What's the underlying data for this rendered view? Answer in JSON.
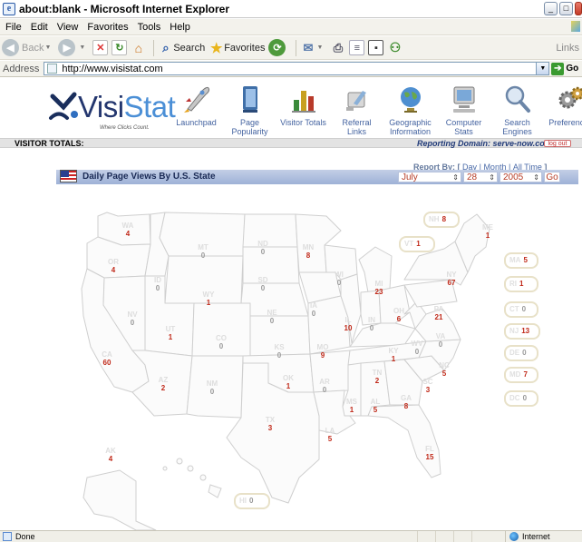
{
  "window": {
    "title": "about:blank - Microsoft Internet Explorer"
  },
  "menu": [
    "File",
    "Edit",
    "View",
    "Favorites",
    "Tools",
    "Help"
  ],
  "toolbar": {
    "back": "Back",
    "search": "Search",
    "favorites": "Favorites",
    "links": "Links"
  },
  "address": {
    "label": "Address",
    "url": "http://www.visistat.com",
    "go": "Go"
  },
  "brand": {
    "name": "VisiStat",
    "tagline": "Where Clicks Count."
  },
  "nav": [
    {
      "label": "Launchpad",
      "icon": "rocket-icon"
    },
    {
      "label": "Page Popularity",
      "icon": "book-icon"
    },
    {
      "label": "Visitor Totals",
      "icon": "bar-chart-icon"
    },
    {
      "label": "Referral Links",
      "icon": "referral-hand-icon"
    },
    {
      "label": "Geographic Information",
      "icon": "globe-icon"
    },
    {
      "label": "Computer Stats",
      "icon": "computer-icon"
    },
    {
      "label": "Search Engines",
      "icon": "magnifier-icon"
    },
    {
      "label": "Preferences",
      "icon": "gears-icon"
    }
  ],
  "totals_bar": {
    "label": "VISITOR TOTALS:",
    "domain_label": "Reporting Domain:",
    "domain": "serve-now.com",
    "logout": "log out"
  },
  "report": {
    "by_label": "Report By:",
    "open_bracket": "[",
    "close_bracket": "]",
    "options": [
      "Day",
      "Month",
      "All Time"
    ],
    "separator": "|",
    "panel_title": "Daily Page Views By U.S. State",
    "month": "July",
    "day": "28",
    "year": "2005",
    "go": "Go"
  },
  "states": [
    {
      "abbr": "WA",
      "value": "4"
    },
    {
      "abbr": "OR",
      "value": "4"
    },
    {
      "abbr": "CA",
      "value": "60"
    },
    {
      "abbr": "NV",
      "value": "0"
    },
    {
      "abbr": "ID",
      "value": "0"
    },
    {
      "abbr": "MT",
      "value": "0"
    },
    {
      "abbr": "WY",
      "value": "1"
    },
    {
      "abbr": "UT",
      "value": "1"
    },
    {
      "abbr": "AZ",
      "value": "2"
    },
    {
      "abbr": "CO",
      "value": "0"
    },
    {
      "abbr": "NM",
      "value": "0"
    },
    {
      "abbr": "ND",
      "value": "0"
    },
    {
      "abbr": "SD",
      "value": "0"
    },
    {
      "abbr": "NE",
      "value": "0"
    },
    {
      "abbr": "KS",
      "value": "0"
    },
    {
      "abbr": "OK",
      "value": "1"
    },
    {
      "abbr": "TX",
      "value": "3"
    },
    {
      "abbr": "MN",
      "value": "8"
    },
    {
      "abbr": "IA",
      "value": "0"
    },
    {
      "abbr": "MO",
      "value": "9"
    },
    {
      "abbr": "AR",
      "value": "0"
    },
    {
      "abbr": "LA",
      "value": "5"
    },
    {
      "abbr": "WI",
      "value": "0"
    },
    {
      "abbr": "IL",
      "value": "10"
    },
    {
      "abbr": "MI",
      "value": "23"
    },
    {
      "abbr": "IN",
      "value": "0"
    },
    {
      "abbr": "OH",
      "value": "6"
    },
    {
      "abbr": "KY",
      "value": "1"
    },
    {
      "abbr": "TN",
      "value": "2"
    },
    {
      "abbr": "MS",
      "value": "1"
    },
    {
      "abbr": "AL",
      "value": "5"
    },
    {
      "abbr": "GA",
      "value": "8"
    },
    {
      "abbr": "FL",
      "value": "15"
    },
    {
      "abbr": "SC",
      "value": "3"
    },
    {
      "abbr": "NC",
      "value": "5"
    },
    {
      "abbr": "VA",
      "value": "0"
    },
    {
      "abbr": "WV",
      "value": "0"
    },
    {
      "abbr": "PA",
      "value": "21"
    },
    {
      "abbr": "NY",
      "value": "67"
    },
    {
      "abbr": "ME",
      "value": "1"
    },
    {
      "abbr": "AK",
      "value": "4"
    }
  ],
  "boxed_states": [
    {
      "abbr": "NH",
      "value": "8"
    },
    {
      "abbr": "VT",
      "value": "1"
    },
    {
      "abbr": "MA",
      "value": "5"
    },
    {
      "abbr": "RI",
      "value": "1"
    },
    {
      "abbr": "CT",
      "value": "0"
    },
    {
      "abbr": "NJ",
      "value": "13"
    },
    {
      "abbr": "DE",
      "value": "0"
    },
    {
      "abbr": "MD",
      "value": "7"
    },
    {
      "abbr": "DC",
      "value": "0"
    },
    {
      "abbr": "HI",
      "value": "0"
    }
  ],
  "status": {
    "text": "Done",
    "zone": "Internet"
  }
}
